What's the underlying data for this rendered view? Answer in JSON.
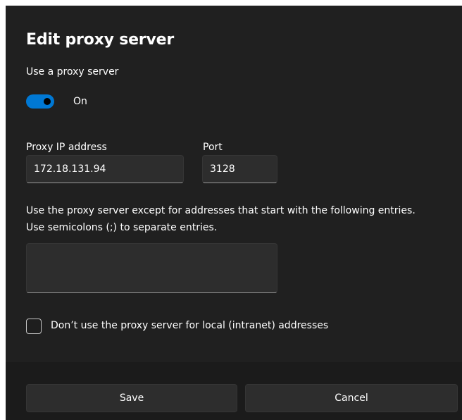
{
  "dialog": {
    "title": "Edit proxy server",
    "use_proxy_label": "Use a proxy server",
    "toggle_state_label": "On",
    "proxy_ip_label": "Proxy IP address",
    "proxy_ip_value": "172.18.131.94",
    "port_label": "Port",
    "port_value": "3128",
    "exceptions_line1": "Use the proxy server except for addresses that start with the following entries.",
    "exceptions_line2": "Use semicolons (;) to separate entries.",
    "exceptions_value": "",
    "local_checkbox_label": "Don’t use the proxy server for local (intranet) addresses",
    "local_checkbox_checked": false
  },
  "buttons": {
    "save_label": "Save",
    "cancel_label": "Cancel"
  },
  "colors": {
    "background": "#202020",
    "accent": "#0078d4",
    "control": "#2d2d2d",
    "footer": "#1b1b1b"
  }
}
